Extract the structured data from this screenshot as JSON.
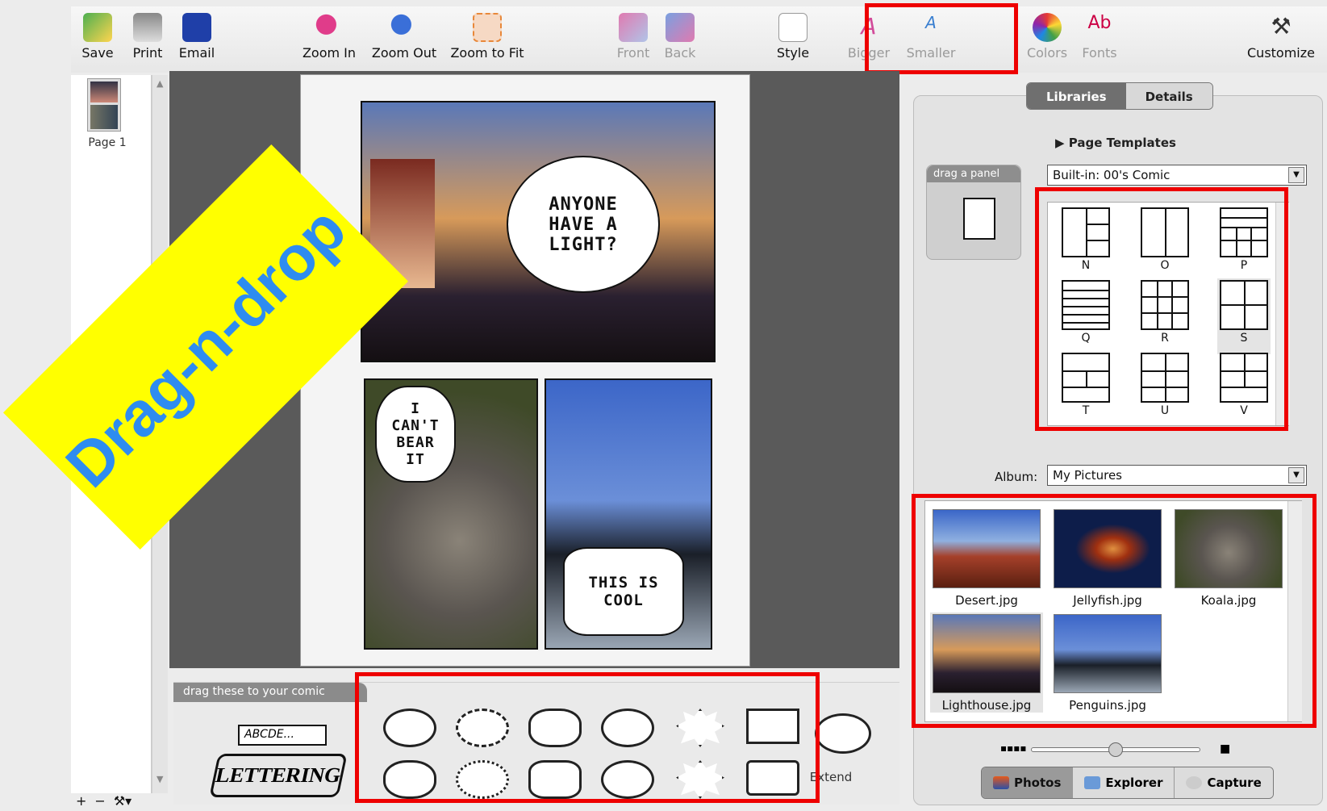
{
  "toolbar": {
    "save": "Save",
    "print": "Print",
    "email": "Email",
    "zoom_in": "Zoom In",
    "zoom_out": "Zoom Out",
    "zoom_to_fit": "Zoom to Fit",
    "front": "Front",
    "back": "Back",
    "style": "Style",
    "bigger": "Bigger",
    "smaller": "Smaller",
    "colors": "Colors",
    "fonts": "Fonts",
    "customize": "Customize"
  },
  "pages_panel": {
    "page_label": "Page 1"
  },
  "banner": {
    "text": "Drag-n-drop"
  },
  "comic": {
    "bubble1": "ANYONE HAVE A LIGHT?",
    "bubble2": "I CAN'T BEAR IT",
    "bubble3": "THIS IS COOL"
  },
  "palette": {
    "header": "drag these to your comic",
    "lettering_input": "ABCDE...",
    "lettering_logo": "LETTERING",
    "extend": "Extend"
  },
  "right_panel": {
    "tabs": [
      "Libraries",
      "Details"
    ],
    "section": "Page Templates",
    "drag_panel": "drag a panel",
    "template_select": "Built-in: 00's Comic",
    "templates": [
      "N",
      "O",
      "P",
      "Q",
      "R",
      "S",
      "T",
      "U",
      "V"
    ],
    "album_label": "Album:",
    "album_select": "My Pictures",
    "photos": [
      "Desert.jpg",
      "Jellyfish.jpg",
      "Koala.jpg",
      "Lighthouse.jpg",
      "Penguins.jpg"
    ],
    "bottom_tabs": [
      "Photos",
      "Explorer",
      "Capture"
    ],
    "thumb_size": 0.5
  },
  "bottom_tools": {
    "add": "+",
    "remove": "−",
    "tools": "⚒▾"
  },
  "colors": {
    "highlight": "#ee0000",
    "banner_bg": "#ffff00",
    "banner_text": "#2e8cf0"
  }
}
